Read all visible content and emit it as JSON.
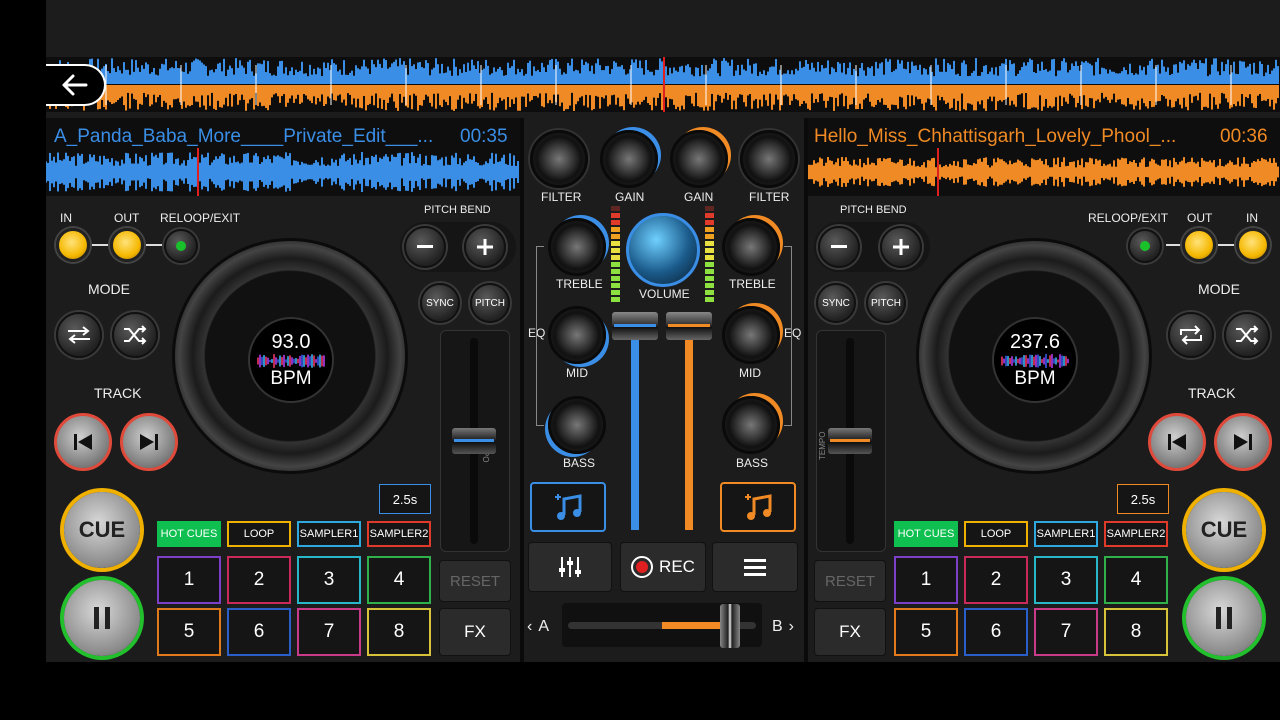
{
  "colors": {
    "deck_a": "#3a8ee6",
    "deck_b": "#f08a24",
    "hot_cues": "#0fbf4f"
  },
  "deck_a": {
    "track_title": "A_Panda_Baba_More____Private_Edit___...",
    "time": "00:35",
    "bpm": "93.0",
    "bpm_unit": "BPM",
    "loop_labels": {
      "in": "IN",
      "out": "OUT",
      "reloop": "RELOOP/EXIT"
    },
    "mode_label": "MODE",
    "track_label": "TRACK",
    "pitch_bend": "PITCH BEND",
    "sync": "SYNC",
    "pitch": "PITCH",
    "tempo": "TEMPO",
    "step": "2.5s",
    "cue": "CUE",
    "reset": "RESET",
    "fx": "FX",
    "tabs": [
      "HOT CUES",
      "LOOP",
      "SAMPLER1",
      "SAMPLER2"
    ],
    "pads": [
      "1",
      "2",
      "3",
      "4",
      "5",
      "6",
      "7",
      "8"
    ]
  },
  "deck_b": {
    "track_title": "Hello_Miss_Chhattisgarh_Lovely_Phool_...",
    "time": "00:36",
    "bpm": "237.6",
    "bpm_unit": "BPM",
    "loop_labels": {
      "in": "IN",
      "out": "OUT",
      "reloop": "RELOOP/EXIT"
    },
    "mode_label": "MODE",
    "track_label": "TRACK",
    "pitch_bend": "PITCH BEND",
    "sync": "SYNC",
    "pitch": "PITCH",
    "tempo": "TEMPO",
    "step": "2.5s",
    "cue": "CUE",
    "reset": "RESET",
    "fx": "FX",
    "tabs": [
      "HOT CUES",
      "LOOP",
      "SAMPLER1",
      "SAMPLER2"
    ],
    "pads": [
      "1",
      "2",
      "3",
      "4",
      "5",
      "6",
      "7",
      "8"
    ]
  },
  "mixer": {
    "filter": "FILTER",
    "gain": "GAIN",
    "treble": "TREBLE",
    "volume": "VOLUME",
    "eq": "EQ",
    "mid": "MID",
    "bass": "BASS",
    "rec": "REC",
    "crossfader_a": "A",
    "crossfader_b": "B",
    "crossfader_position": 0.86
  },
  "icons": {
    "back": "arrow-left-icon",
    "minus": "minus-icon",
    "plus": "plus-icon",
    "mode1": "repeat-icon",
    "mode2": "shuffle-icon",
    "prev": "skip-previous-icon",
    "next": "skip-next-icon",
    "pause": "pause-icon",
    "music": "music-add-icon",
    "eq": "sliders-icon",
    "rec": "record-icon",
    "menu": "menu-icon"
  }
}
